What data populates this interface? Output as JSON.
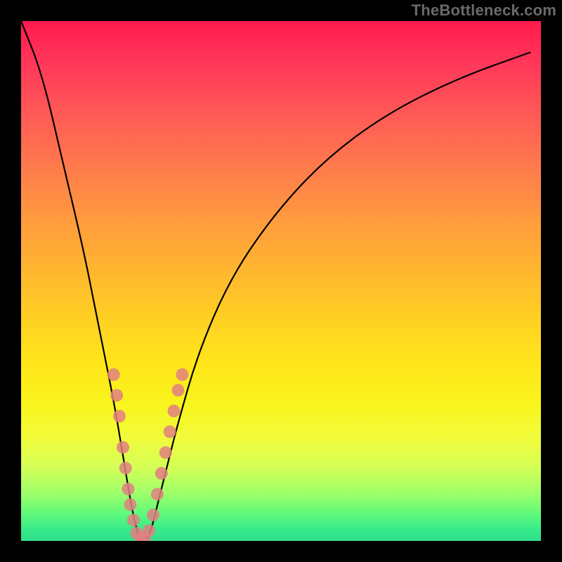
{
  "watermark": "TheBottleneck.com",
  "chart_data": {
    "type": "line",
    "title": "",
    "xlabel": "",
    "ylabel": "",
    "xlim": [
      0,
      100
    ],
    "ylim": [
      0,
      100
    ],
    "grid": false,
    "series": [
      {
        "name": "bottleneck-curve",
        "x": [
          0,
          4,
          8,
          12,
          14,
          16,
          18,
          20,
          21,
          22,
          23,
          24,
          25,
          26,
          28,
          30,
          34,
          40,
          48,
          58,
          70,
          84,
          98
        ],
        "y": [
          100,
          90,
          73,
          56,
          46,
          36,
          26,
          14,
          8,
          3,
          0,
          0,
          2,
          6,
          14,
          22,
          36,
          50,
          62,
          73,
          82,
          89,
          94
        ]
      }
    ],
    "markers": {
      "name": "highlighted-points",
      "color": "#e08080",
      "points": [
        {
          "x": 17.8,
          "y": 32
        },
        {
          "x": 18.4,
          "y": 28
        },
        {
          "x": 18.9,
          "y": 24
        },
        {
          "x": 19.6,
          "y": 18
        },
        {
          "x": 20.1,
          "y": 14
        },
        {
          "x": 20.6,
          "y": 10
        },
        {
          "x": 21.0,
          "y": 7
        },
        {
          "x": 21.6,
          "y": 4
        },
        {
          "x": 22.2,
          "y": 1.5
        },
        {
          "x": 23.0,
          "y": 0.5
        },
        {
          "x": 23.8,
          "y": 0.5
        },
        {
          "x": 24.6,
          "y": 2
        },
        {
          "x": 25.4,
          "y": 5
        },
        {
          "x": 26.2,
          "y": 9
        },
        {
          "x": 27.0,
          "y": 13
        },
        {
          "x": 27.8,
          "y": 17
        },
        {
          "x": 28.6,
          "y": 21
        },
        {
          "x": 29.4,
          "y": 25
        },
        {
          "x": 30.2,
          "y": 29
        },
        {
          "x": 31.0,
          "y": 32
        }
      ]
    },
    "background_bands": [
      {
        "from": 95,
        "to": 100,
        "color": "green"
      },
      {
        "from": 60,
        "to": 95,
        "color": "yellow"
      },
      {
        "from": 20,
        "to": 60,
        "color": "orange"
      },
      {
        "from": 0,
        "to": 20,
        "color": "red"
      }
    ]
  }
}
